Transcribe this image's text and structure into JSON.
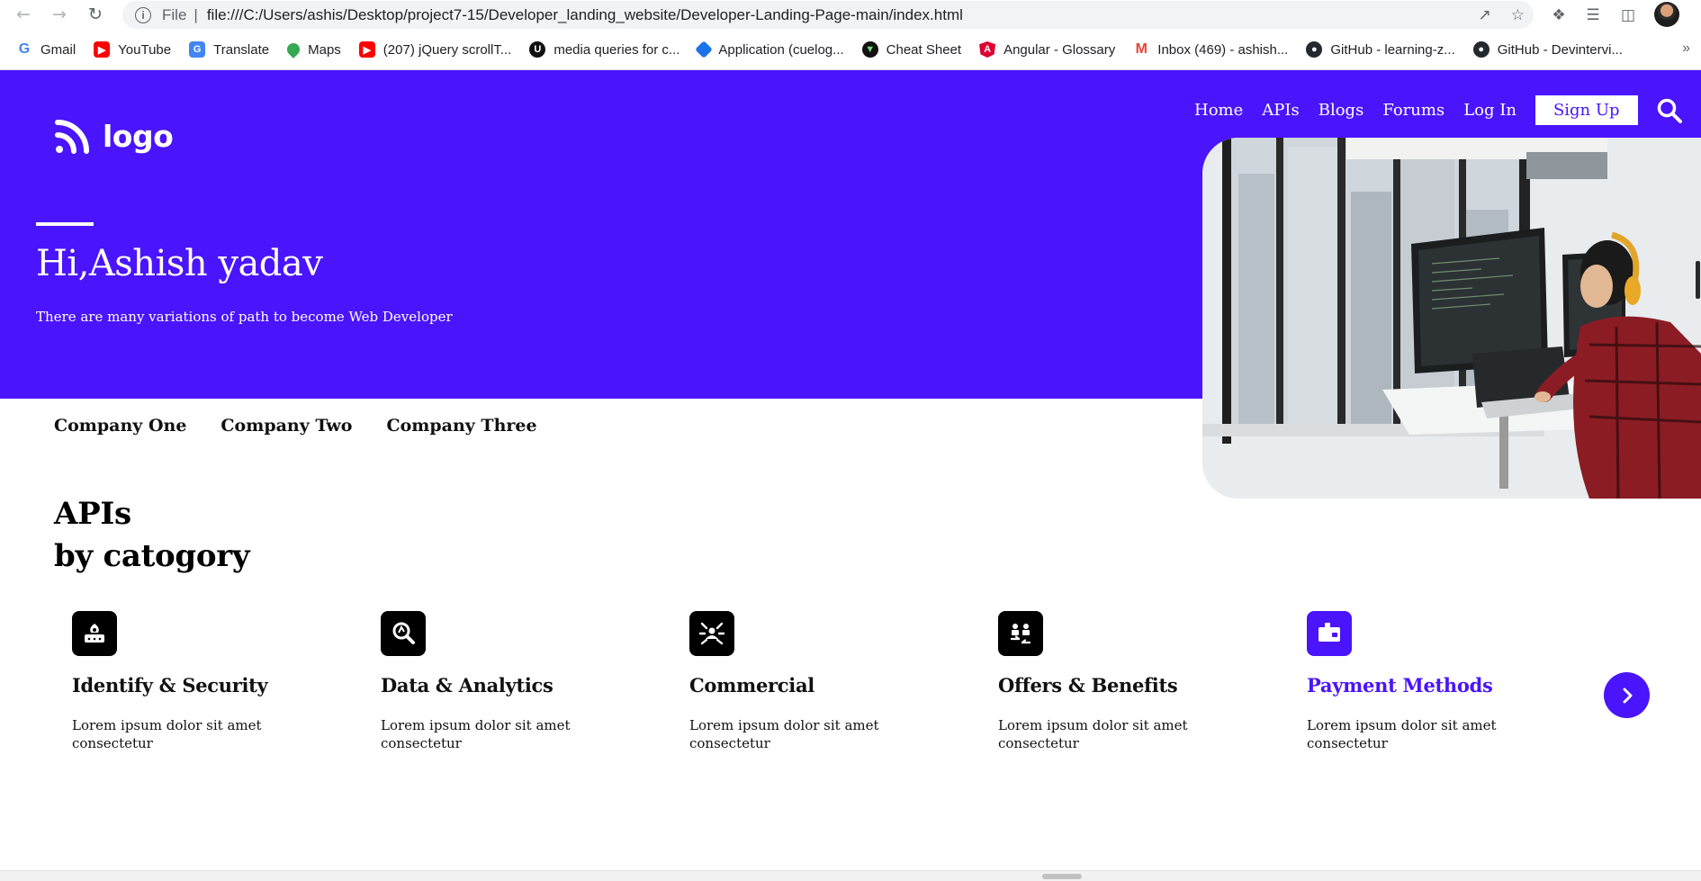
{
  "browser": {
    "url_scheme": "File",
    "url_separator": "|",
    "url": "file:///C:/Users/ashis/Desktop/project7-15/Developer_landing_website/Developer-Landing-Page-main/index.html",
    "bookmarks": [
      {
        "label": "Gmail",
        "icon": "google-icon"
      },
      {
        "label": "YouTube",
        "icon": "youtube-icon"
      },
      {
        "label": "Translate",
        "icon": "translate-icon"
      },
      {
        "label": "Maps",
        "icon": "maps-icon"
      },
      {
        "label": "(207) jQuery scrollT...",
        "icon": "youtube-icon"
      },
      {
        "label": "media queries for c...",
        "icon": "udemy-icon"
      },
      {
        "label": "Application (cuelog...",
        "icon": "hackerrank-icon"
      },
      {
        "label": "Cheat Sheet",
        "icon": "devhints-icon"
      },
      {
        "label": "Angular - Glossary",
        "icon": "angular-icon"
      },
      {
        "label": "Inbox (469) - ashish...",
        "icon": "gmail-icon"
      },
      {
        "label": "GitHub - learning-z...",
        "icon": "github-icon"
      },
      {
        "label": "GitHub - Devintervi...",
        "icon": "github-icon"
      }
    ],
    "bookmarks_overflow": "»"
  },
  "site": {
    "brand_color": "#4a14fc",
    "logo_text": "logo",
    "nav": [
      {
        "label": "Home"
      },
      {
        "label": "APIs"
      },
      {
        "label": "Blogs"
      },
      {
        "label": "Forums"
      },
      {
        "label": "Log In"
      }
    ],
    "signup_label": "Sign Up",
    "hero": {
      "title": "Hi,Ashish yadav",
      "subtitle": "There are many variations of path to become Web Developer"
    },
    "companies": [
      "Company One",
      "Company Two",
      "Company Three"
    ],
    "apis_title_line1": "APIs",
    "apis_title_line2": "by catogory",
    "categories": [
      {
        "title": "Identify & Security",
        "desc": "Lorem ipsum dolor sit amet consectetur",
        "icon": "security-icon"
      },
      {
        "title": "Data & Analytics",
        "desc": "Lorem ipsum dolor sit amet consectetur",
        "icon": "analytics-icon"
      },
      {
        "title": "Commercial",
        "desc": "Lorem ipsum dolor sit amet consectetur",
        "icon": "commercial-icon"
      },
      {
        "title": "Offers & Benefits",
        "desc": "Lorem ipsum dolor sit amet consectetur",
        "icon": "offers-icon"
      },
      {
        "title": "Payment Methods",
        "desc": "Lorem ipsum dolor sit amet consectetur",
        "icon": "payment-icon"
      }
    ]
  }
}
